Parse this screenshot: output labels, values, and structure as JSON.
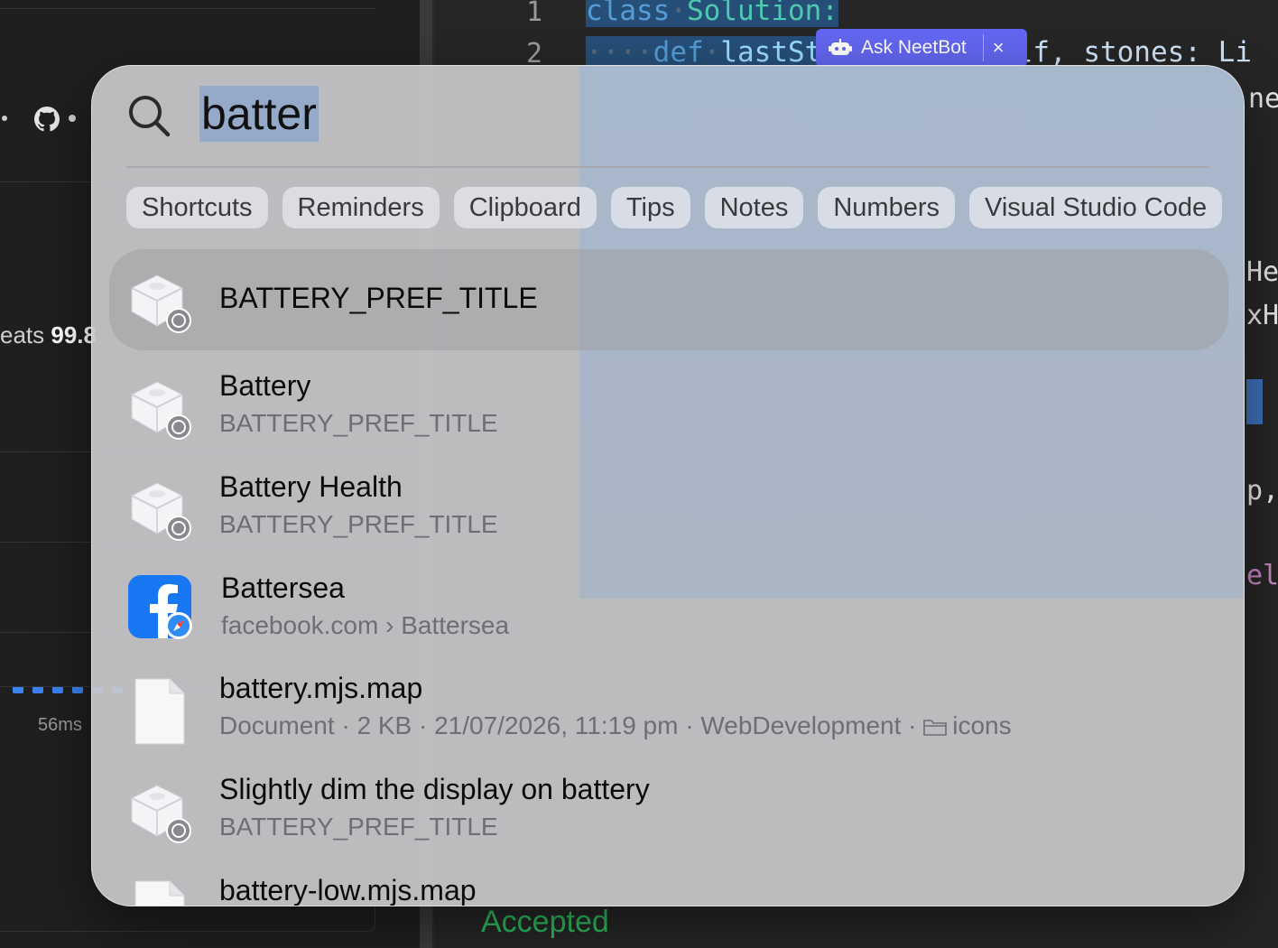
{
  "background": {
    "beats_text": "eats ",
    "beats_value": "99.8",
    "runtime_text": "56ms",
    "line_numbers": [
      "1",
      "2"
    ],
    "code_line1_kw": "class",
    "code_line1_name": "Solution:",
    "code_line2_kw": "def",
    "code_line2_name": "lastSt",
    "code_line2_tail": "elf, stones: Li",
    "right_fragments": [
      "ne",
      "He",
      "xH",
      "p,",
      "el"
    ],
    "accepted": "Accepted"
  },
  "neetbot": {
    "label": "Ask NeetBot",
    "close": "×"
  },
  "spotlight": {
    "query": "batter",
    "chips": [
      "Shortcuts",
      "Reminders",
      "Clipboard",
      "Tips",
      "Notes",
      "Numbers",
      "Visual Studio Code"
    ],
    "results": [
      {
        "title": "BATTERY_PREF_TITLE",
        "subtitle": "",
        "icon": "system-settings-icon",
        "selected": true
      },
      {
        "title": "Battery",
        "subtitle": "BATTERY_PREF_TITLE",
        "icon": "system-settings-icon"
      },
      {
        "title": "Battery Health",
        "subtitle": "BATTERY_PREF_TITLE",
        "icon": "system-settings-icon"
      },
      {
        "title": "Battersea",
        "subtitle": "facebook.com › Battersea",
        "icon": "facebook-safari-icon"
      },
      {
        "title": "battery.mjs.map",
        "subtitle": "Document · 2 KB · 21/07/2026, 11:19 pm · WebDevelopment · ",
        "subtitle_folder": "icons",
        "icon": "document-icon"
      },
      {
        "title": "Slightly dim the display on battery",
        "subtitle": "BATTERY_PREF_TITLE",
        "icon": "system-settings-icon"
      },
      {
        "title": "battery-low.mjs.map",
        "subtitle": "",
        "icon": "document-icon"
      }
    ]
  }
}
